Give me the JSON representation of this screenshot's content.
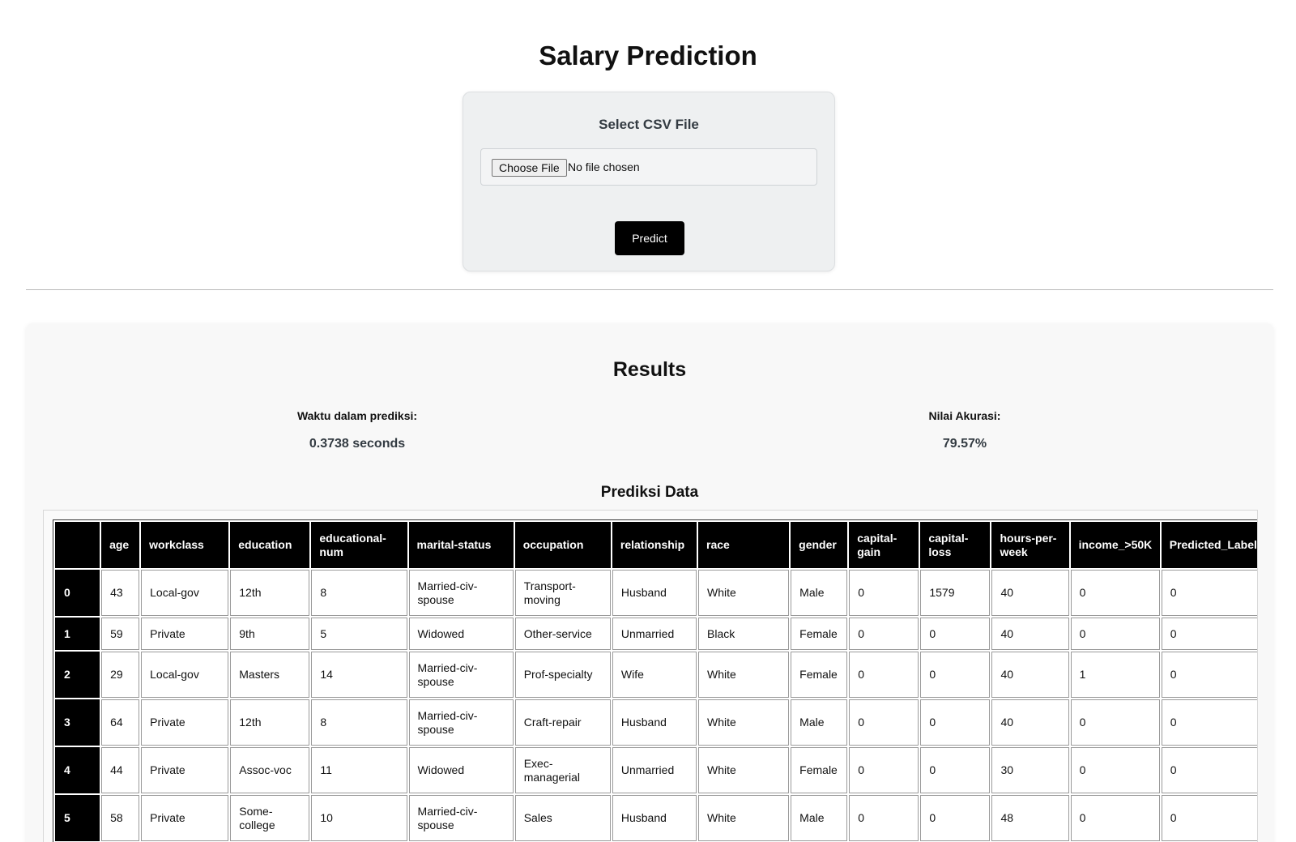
{
  "header": {
    "title": "Salary Prediction"
  },
  "upload": {
    "label": "Select CSV File",
    "choose_button": "Choose File",
    "file_status": "No file chosen",
    "predict_button": "Predict"
  },
  "results": {
    "title": "Results",
    "time_label": "Waktu dalam prediksi:",
    "time_value": "0.3738 seconds",
    "accuracy_label": "Nilai Akurasi:",
    "accuracy_value": "79.57%",
    "table_title": "Prediksi Data"
  },
  "table": {
    "columns": [
      "",
      "age",
      "workclass",
      "education",
      "educational-num",
      "marital-status",
      "occupation",
      "relationship",
      "race",
      "gender",
      "capital-gain",
      "capital-loss",
      "hours-per-week",
      "income_>50K",
      "Predicted_Label"
    ],
    "rows": [
      [
        "0",
        "43",
        "Local-gov",
        "12th",
        "8",
        "Married-civ-spouse",
        "Transport-moving",
        "Husband",
        "White",
        "Male",
        "0",
        "1579",
        "40",
        "0",
        "0"
      ],
      [
        "1",
        "59",
        "Private",
        "9th",
        "5",
        "Widowed",
        "Other-service",
        "Unmarried",
        "Black",
        "Female",
        "0",
        "0",
        "40",
        "0",
        "0"
      ],
      [
        "2",
        "29",
        "Local-gov",
        "Masters",
        "14",
        "Married-civ-spouse",
        "Prof-specialty",
        "Wife",
        "White",
        "Female",
        "0",
        "0",
        "40",
        "1",
        "0"
      ],
      [
        "3",
        "64",
        "Private",
        "12th",
        "8",
        "Married-civ-spouse",
        "Craft-repair",
        "Husband",
        "White",
        "Male",
        "0",
        "0",
        "40",
        "0",
        "0"
      ],
      [
        "4",
        "44",
        "Private",
        "Assoc-voc",
        "11",
        "Widowed",
        "Exec-managerial",
        "Unmarried",
        "White",
        "Female",
        "0",
        "0",
        "30",
        "0",
        "0"
      ],
      [
        "5",
        "58",
        "Private",
        "Some-college",
        "10",
        "Married-civ-spouse",
        "Sales",
        "Husband",
        "White",
        "Male",
        "0",
        "0",
        "48",
        "0",
        "0"
      ]
    ]
  }
}
